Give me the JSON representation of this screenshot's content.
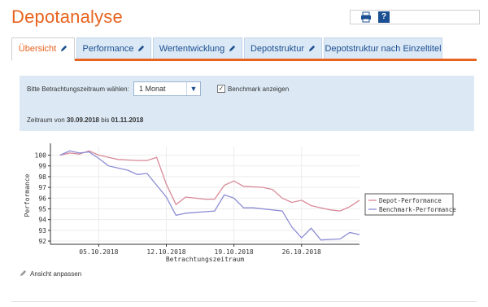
{
  "page": {
    "title": "Depotanalyse"
  },
  "toolbar": {
    "print_icon": "printer-icon",
    "help_label": "?"
  },
  "tabs": [
    {
      "label": "Übersicht",
      "active": true
    },
    {
      "label": "Performance",
      "active": false
    },
    {
      "label": "Wertentwicklung",
      "active": false
    },
    {
      "label": "Depotstruktur",
      "active": false
    },
    {
      "label": "Depotstruktur nach Einzeltitel",
      "active": false
    }
  ],
  "filter": {
    "period_label": "Bitte Betrachtungszeitraum wählen:",
    "period_value": "1 Monat",
    "benchmark_label": "Benchmark anzeigen",
    "benchmark_checked": true,
    "range_prefix": "Zeitraum von",
    "range_from": "30.09.2018",
    "range_mid": "bis",
    "range_to": "01.11.2018"
  },
  "chart_data": {
    "type": "line",
    "xlabel": "Betrachtungszeitraum",
    "ylabel": "Performance",
    "ylim": [
      91.7,
      100.8
    ],
    "xlim": [
      "2018-09-30",
      "2018-11-01"
    ],
    "yticks": [
      92,
      93,
      94,
      95,
      96,
      97,
      98,
      99,
      100
    ],
    "xticks": [
      "05.10.2018",
      "12.10.2018",
      "19.10.2018",
      "26.10.2018"
    ],
    "grid": true,
    "legend_position": "right",
    "series": [
      {
        "name": "Depot-Performance",
        "color": "#d88a98",
        "points": [
          [
            "2018-10-01",
            100.0
          ],
          [
            "2018-10-02",
            100.2
          ],
          [
            "2018-10-03",
            100.1
          ],
          [
            "2018-10-04",
            100.4
          ],
          [
            "2018-10-05",
            100.0
          ],
          [
            "2018-10-07",
            99.6
          ],
          [
            "2018-10-09",
            99.5
          ],
          [
            "2018-10-10",
            99.5
          ],
          [
            "2018-10-11",
            99.8
          ],
          [
            "2018-10-12",
            97.3
          ],
          [
            "2018-10-13",
            95.4
          ],
          [
            "2018-10-14",
            96.1
          ],
          [
            "2018-10-16",
            95.9
          ],
          [
            "2018-10-17",
            95.9
          ],
          [
            "2018-10-18",
            97.2
          ],
          [
            "2018-10-19",
            97.6
          ],
          [
            "2018-10-20",
            97.1
          ],
          [
            "2018-10-22",
            97.0
          ],
          [
            "2018-10-23",
            96.8
          ],
          [
            "2018-10-24",
            96.0
          ],
          [
            "2018-10-25",
            95.6
          ],
          [
            "2018-10-26",
            95.8
          ],
          [
            "2018-10-27",
            95.3
          ],
          [
            "2018-10-28",
            95.1
          ],
          [
            "2018-10-29",
            94.9
          ],
          [
            "2018-10-30",
            94.8
          ],
          [
            "2018-10-31",
            95.2
          ],
          [
            "2018-11-01",
            95.8
          ]
        ]
      },
      {
        "name": "Benchmark-Performance",
        "color": "#8c8cd4",
        "points": [
          [
            "2018-10-01",
            100.0
          ],
          [
            "2018-10-02",
            100.4
          ],
          [
            "2018-10-03",
            100.2
          ],
          [
            "2018-10-04",
            100.3
          ],
          [
            "2018-10-05",
            99.7
          ],
          [
            "2018-10-06",
            99.0
          ],
          [
            "2018-10-08",
            98.6
          ],
          [
            "2018-10-09",
            98.2
          ],
          [
            "2018-10-10",
            98.3
          ],
          [
            "2018-10-12",
            96.1
          ],
          [
            "2018-10-13",
            94.4
          ],
          [
            "2018-10-14",
            94.6
          ],
          [
            "2018-10-17",
            94.8
          ],
          [
            "2018-10-18",
            96.3
          ],
          [
            "2018-10-19",
            96.0
          ],
          [
            "2018-10-20",
            95.1
          ],
          [
            "2018-10-21",
            95.1
          ],
          [
            "2018-10-24",
            94.8
          ],
          [
            "2018-10-25",
            93.3
          ],
          [
            "2018-10-26",
            92.3
          ],
          [
            "2018-10-27",
            93.2
          ],
          [
            "2018-10-28",
            92.1
          ],
          [
            "2018-10-30",
            92.2
          ],
          [
            "2018-10-31",
            92.8
          ],
          [
            "2018-11-01",
            92.6
          ]
        ]
      }
    ]
  },
  "customize": {
    "label": "Ansicht anpassen"
  }
}
